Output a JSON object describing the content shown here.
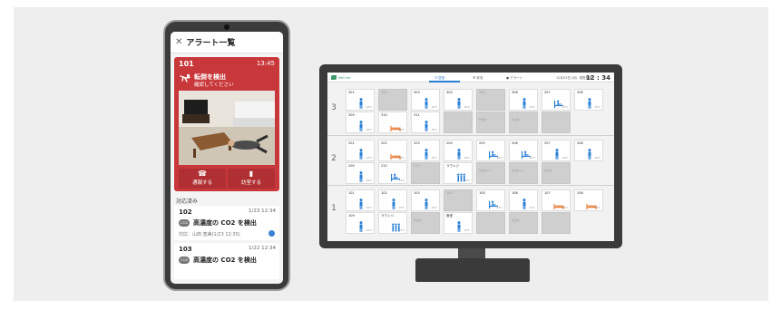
{
  "phone": {
    "header": {
      "close_icon": "close-icon",
      "title": "アラート一覧"
    },
    "alert": {
      "room": "101",
      "time": "13:45",
      "icon": "fall-icon",
      "title": "転倒を検出",
      "subtitle": "確認してください",
      "buttons": [
        {
          "icon": "call-icon",
          "label": "通報する"
        },
        {
          "icon": "door-icon",
          "label": "訪室する"
        }
      ],
      "color": "#c8373a"
    },
    "done_section_label": "対応済み",
    "done": [
      {
        "room": "102",
        "time": "1/23 12:34",
        "badge": "CO2",
        "message": "高濃度の CO2 を検出",
        "handler": "対応：山田 恵美(1/23 12:35)"
      },
      {
        "room": "103",
        "time": "1/22 12:34",
        "badge": "CO2",
        "message": "高濃度の CO2 を検出",
        "handler": ""
      }
    ]
  },
  "monitor": {
    "topbar": {
      "app_name": "MeCare",
      "tabs": [
        "☷ 居室",
        "☰ 状況",
        "● アラート"
      ],
      "date": "12月23日 (月)",
      "clock_label": "現在時刻",
      "clock": "12 : 34"
    },
    "accent": "#2a7fd4",
    "floors": [
      {
        "number": "3",
        "rooms": [
          {
            "n": "301",
            "s": "stand",
            "t": "24℃"
          },
          {
            "n": "302",
            "s": "gray",
            "t": ""
          },
          {
            "n": "303",
            "s": "stand",
            "t": "24℃"
          },
          {
            "n": "304",
            "s": "stand",
            "t": "24℃"
          },
          {
            "n": "305",
            "s": "gray",
            "t": ""
          },
          {
            "n": "306",
            "s": "stand",
            "t": "24℃"
          },
          {
            "n": "307",
            "s": "sit",
            "t": "24℃"
          },
          {
            "n": "308",
            "s": "stand",
            "t": "24℃"
          },
          {
            "n": "309",
            "s": "stand",
            "t": "24℃"
          },
          {
            "n": "310",
            "s": "bed",
            "t": "24℃"
          },
          {
            "n": "311",
            "s": "stand",
            "t": "24℃"
          },
          {
            "n": "",
            "s": "gray",
            "t": ""
          },
          {
            "n": "",
            "s": "gray",
            "t": "",
            "l": "外出中"
          },
          {
            "n": "",
            "s": "gray",
            "t": "",
            "l": "外出中"
          },
          {
            "n": "",
            "s": "gray",
            "t": ""
          }
        ]
      },
      {
        "number": "2",
        "rooms": [
          {
            "n": "201",
            "s": "stand",
            "t": "24℃"
          },
          {
            "n": "202",
            "s": "bed",
            "t": "24℃"
          },
          {
            "n": "203",
            "s": "stand",
            "t": "24℃"
          },
          {
            "n": "204",
            "s": "stand",
            "t": "24℃"
          },
          {
            "n": "205",
            "s": "sit",
            "t": "24℃"
          },
          {
            "n": "206",
            "s": "sit",
            "t": "24℃"
          },
          {
            "n": "207",
            "s": "stand",
            "t": "24℃"
          },
          {
            "n": "208",
            "s": "stand",
            "t": "24℃"
          },
          {
            "n": "209",
            "s": "stand",
            "t": "24℃"
          },
          {
            "n": "210",
            "s": "sit",
            "t": "24℃"
          },
          {
            "n": "211",
            "s": "gray",
            "t": ""
          },
          {
            "n": "ラウンジ",
            "s": "group",
            "t": "24℃"
          },
          {
            "n": "",
            "s": "gray",
            "t": "",
            "l": "外出中 (1)"
          },
          {
            "n": "",
            "s": "gray",
            "t": "",
            "l": "外出中 (2)"
          },
          {
            "n": "",
            "s": "gray",
            "t": "",
            "l": "外出中"
          }
        ]
      },
      {
        "number": "1",
        "rooms": [
          {
            "n": "101",
            "s": "stand",
            "t": "24℃"
          },
          {
            "n": "102",
            "s": "stand",
            "t": "24℃"
          },
          {
            "n": "103",
            "s": "stand",
            "t": "24℃"
          },
          {
            "n": "104",
            "s": "gray",
            "t": ""
          },
          {
            "n": "105",
            "s": "sit",
            "t": "24℃"
          },
          {
            "n": "106",
            "s": "stand",
            "t": "24℃"
          },
          {
            "n": "107",
            "s": "bed",
            "t": "24℃"
          },
          {
            "n": "108",
            "s": "bed",
            "t": "24℃"
          },
          {
            "n": "109",
            "s": "stand",
            "t": "24℃"
          },
          {
            "n": "ラウンジ",
            "s": "group",
            "t": "24℃"
          },
          {
            "n": "",
            "s": "gray",
            "t": "",
            "l": "外出中"
          },
          {
            "n": "食堂",
            "s": "stand",
            "t": "24℃"
          },
          {
            "n": "",
            "s": "gray",
            "t": ""
          },
          {
            "n": "",
            "s": "gray",
            "t": "",
            "l": "外出中"
          },
          {
            "n": "",
            "s": "gray",
            "t": ""
          }
        ]
      }
    ]
  }
}
